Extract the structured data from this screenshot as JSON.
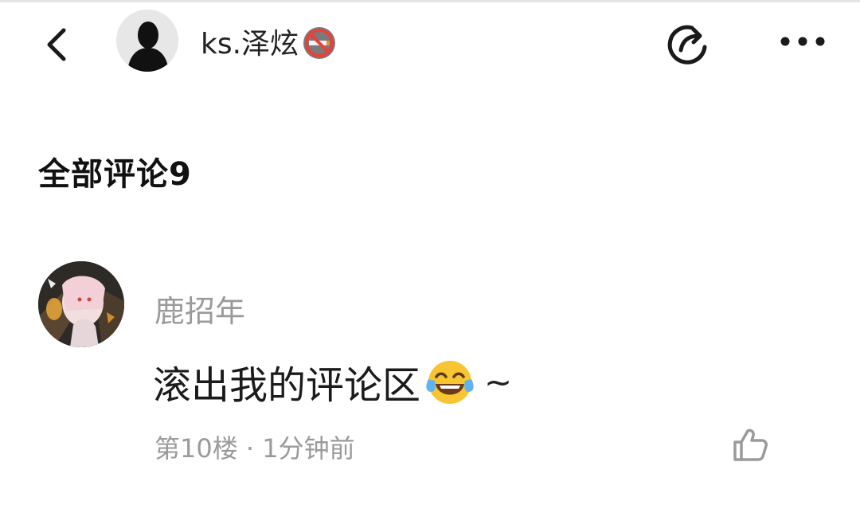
{
  "header": {
    "author_name": "ks.泽炫",
    "icons": {
      "back": "chevron-left-icon",
      "share": "share-icon",
      "more": "more-dots-icon",
      "badge": "no-smoking-icon"
    }
  },
  "comments": {
    "title": "全部评论9",
    "items": [
      {
        "author": "鹿招年",
        "text": "滚出我的评论区",
        "emoji": "face-with-tears-of-joy",
        "suffix": "~",
        "meta": "第10楼 · 1分钟前",
        "like_icon": "thumbs-up-icon"
      }
    ]
  },
  "colors": {
    "text_primary": "#1a1a1a",
    "text_secondary": "#9a9a9a",
    "background": "#ffffff",
    "badge_red": "#e8403a"
  }
}
